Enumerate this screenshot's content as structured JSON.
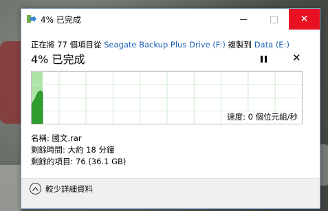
{
  "window": {
    "title": "4% 已完成",
    "close_glyph": "✕",
    "maximize_glyph": "",
    "minimize_glyph": ""
  },
  "copy_info": {
    "prefix": "正在將 77 個項目從 ",
    "source": "Seagate Backup Plus Drive (F:)",
    "middle": " 複製到 ",
    "destination": "Data (E:)"
  },
  "progress": {
    "text": "4% 已完成",
    "fraction": 0.04,
    "speed_label": "速度: 0 個位元組/秒"
  },
  "details": {
    "name": "名稱: 國文.rar",
    "time_remaining": "剩餘時間: 大約 18 分鐘",
    "items_remaining": "剩餘的項目: 76 (36.1 GB)"
  },
  "footer": {
    "fewer_details": "較少詳細資料"
  },
  "colors": {
    "progress_fill": "#a6e3a0",
    "speed_line": "#2f9e2f",
    "close_button": "#e81123",
    "link": "#1a5fb4"
  },
  "icons": {
    "title": "copy-arrow-icon",
    "pause": "pause-icon",
    "cancel": "close-icon",
    "fewer": "chevron-up-circle-icon"
  }
}
